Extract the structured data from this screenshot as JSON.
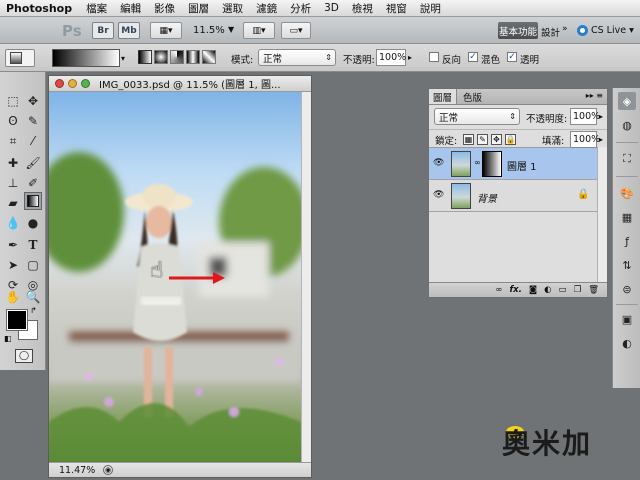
{
  "menubar": {
    "app_name": "Photoshop",
    "items": [
      "檔案",
      "編輯",
      "影像",
      "圖層",
      "選取",
      "濾鏡",
      "分析",
      "3D",
      "檢視",
      "視窗",
      "說明"
    ]
  },
  "appbar": {
    "logo": "Ps",
    "bridge": "Br",
    "minibridge": "Mb",
    "zoom": "11.5%",
    "workspace_active": "基本功能",
    "workspace_design": "設計",
    "workspace_more": "»",
    "cs_live": "CS Live"
  },
  "options": {
    "mode_label": "模式:",
    "mode_value": "正常",
    "opacity_label": "不透明:",
    "opacity_value": "100%",
    "reverse_label": "反向",
    "dither_label": "混色",
    "transparency_label": "透明",
    "reverse_checked": false,
    "dither_checked": true,
    "transparency_checked": true
  },
  "document": {
    "title": "IMG_0033.psd @ 11.5% (圖層 1, 圖...",
    "status_zoom": "11.47%"
  },
  "layers_panel": {
    "tab_layers": "圖層",
    "tab_channels": "色版",
    "menu_glyph": "▸▸ ≡",
    "blend_mode": "正常",
    "opacity_label": "不透明度:",
    "opacity_value": "100%",
    "lock_label": "鎖定:",
    "fill_label": "填滿:",
    "fill_value": "100%",
    "layers": [
      {
        "name": "圖層 1",
        "selected": true,
        "has_mask": true
      },
      {
        "name": "背景",
        "selected": false,
        "locked": true
      }
    ],
    "footer_icons": [
      "link-icon",
      "fx-icon",
      "mask-icon",
      "adjustment-icon",
      "group-icon",
      "new-layer-icon",
      "trash-icon"
    ],
    "footer_fx": "fx."
  },
  "watermark": "奧米加",
  "colors": {
    "foreground": "#000000",
    "background": "#ffffff",
    "selected_layer": "#a7c5ed",
    "drag_arrow": "#e0181b"
  }
}
